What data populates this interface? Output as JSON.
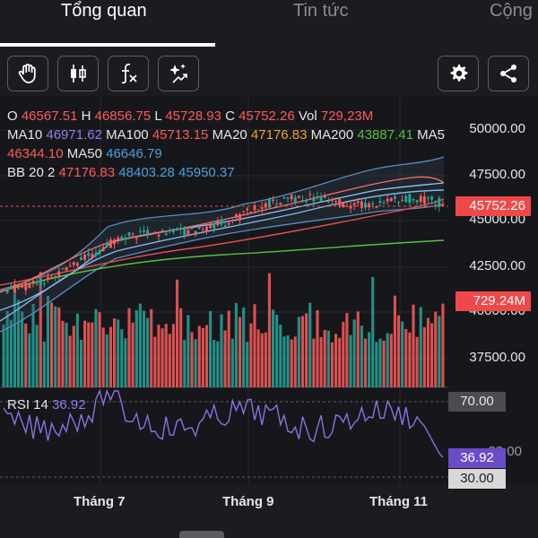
{
  "tabs": [
    {
      "label": "Tổng quan",
      "active": true
    },
    {
      "label": "Tin tức",
      "active": false
    },
    {
      "label": "Cộng",
      "active": false
    }
  ],
  "toolbar": {
    "left_buttons": [
      "hand-icon",
      "candlestick-icon",
      "function-icon",
      "sparkle-icon"
    ],
    "right_buttons": [
      "gear-icon",
      "share-icon"
    ]
  },
  "legend": {
    "ohlc": {
      "o_label": "O",
      "o": "46567.51",
      "h_label": "H",
      "h": "46856.75",
      "l_label": "L",
      "l": "45728.93",
      "c_label": "C",
      "c": "45752.26",
      "vol_label": "Vol",
      "vol": "729,23M"
    },
    "ma": {
      "ma10_label": "MA10",
      "ma10": "46971.62",
      "ma100_label": "MA100",
      "ma100": "45713.15",
      "ma20_label": "MA20",
      "ma20": "47176.83",
      "ma200_label": "MA200",
      "ma200": "43887.41",
      "ma5_label": "MA5"
    },
    "ma_row2": {
      "ma5": "46344.10",
      "ma50_label": "MA50",
      "ma50": "46646.79"
    },
    "bb": {
      "label": "BB 20 2",
      "mid": "47176.83",
      "upper": "48403.28",
      "lower": "45950.37"
    }
  },
  "price_axis": [
    "50000.00",
    "47500.00",
    "45000.00",
    "42500.00",
    "40000.00",
    "37500.00"
  ],
  "last_price_tag": "45752.26",
  "volume_tag": "729.24M",
  "rsi": {
    "label": "RSI 14",
    "value": "36.92",
    "upper": "70.00",
    "lower": "30.00",
    "partial_tick": "33.00"
  },
  "time_axis": [
    "Tháng 7",
    "Tháng 9",
    "Tháng 11"
  ],
  "colors": {
    "up": "#26a69a",
    "down": "#ff5a5a",
    "accent": "#8e70e0"
  }
}
